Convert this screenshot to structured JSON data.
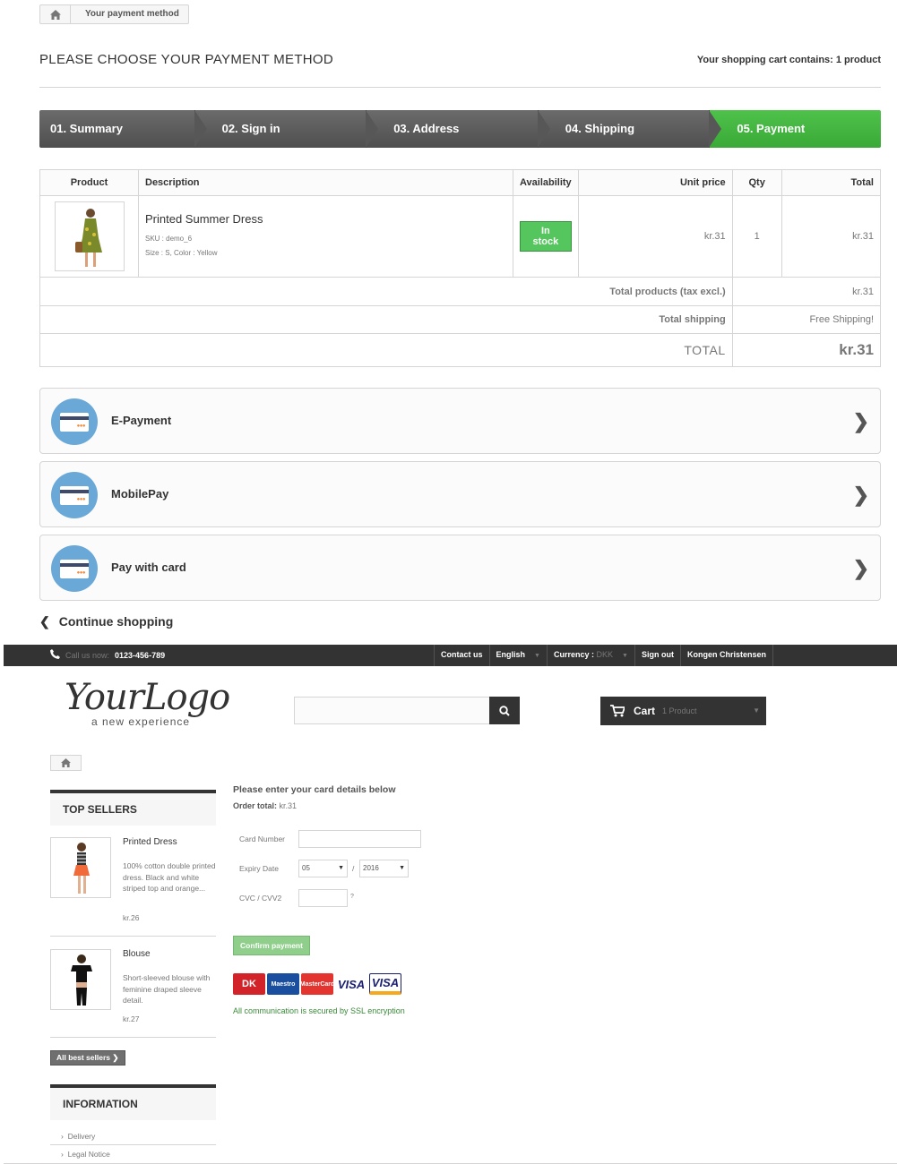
{
  "breadcrumb": {
    "current": "Your payment method"
  },
  "page_title": "PLEASE CHOOSE YOUR PAYMENT METHOD",
  "cart_summary": "Your shopping cart contains: 1 product",
  "steps": [
    {
      "label": "01. Summary"
    },
    {
      "label": "02. Sign in"
    },
    {
      "label": "03. Address"
    },
    {
      "label": "04. Shipping"
    },
    {
      "label": "05. Payment"
    }
  ],
  "colors": {
    "active_step": "#46b743",
    "step": "#575757",
    "icon_bg": "#6aa8d8"
  },
  "cart_table": {
    "headers": [
      "Product",
      "Description",
      "Availability",
      "Unit price",
      "Qty",
      "Total"
    ],
    "item": {
      "name": "Printed Summer Dress",
      "sku": "SKU : demo_6",
      "attributes": "Size : S, Color : Yellow",
      "availability": "In stock",
      "unit_price": "kr.31",
      "qty": "1",
      "total": "kr.31"
    },
    "total_products_label": "Total products (tax excl.)",
    "total_products_value": "kr.31",
    "total_shipping_label": "Total shipping",
    "total_shipping_value": "Free Shipping!",
    "total_label": "TOTAL",
    "total_value": "kr.31"
  },
  "payment_methods": [
    {
      "label": "E-Payment",
      "icon": "credit-card-icon"
    },
    {
      "label": "MobilePay",
      "icon": "credit-card-icon"
    },
    {
      "label": "Pay with card",
      "icon": "credit-card-icon"
    }
  ],
  "continue_shopping": "Continue shopping",
  "store": {
    "nav": {
      "call_label": "Call us now:",
      "phone": "0123-456-789",
      "contact": "Contact us",
      "language": "English",
      "currency_label": "Currency :",
      "currency_value": "DKK",
      "sign_out": "Sign out",
      "user": "Kongen Christensen"
    },
    "logo": {
      "main": "YourLogo",
      "tagline": "a new experience"
    },
    "search": {
      "placeholder": ""
    },
    "cart": {
      "label": "Cart",
      "qty": "1 Product"
    },
    "top_sellers": {
      "title": "TOP SELLERS",
      "items": [
        {
          "name": "Printed Dress",
          "desc": "100% cotton double printed dress. Black and white striped top and orange...",
          "price": "kr.26"
        },
        {
          "name": "Blouse",
          "desc": "Short-sleeved blouse with feminine draped sleeve detail.",
          "price": "kr.27"
        }
      ],
      "all_button": "All best sellers"
    },
    "information": {
      "title": "INFORMATION",
      "links": [
        "Delivery",
        "Legal Notice"
      ]
    },
    "card_form": {
      "title": "Please enter your card details below",
      "order_total_label": "Order total:",
      "order_total_value": "kr.31",
      "card_number_label": "Card Number",
      "expiry_label": "Expiry Date",
      "expiry_month": "05",
      "expiry_sep": "/",
      "expiry_year": "2016",
      "cvc_label": "CVC / CVV2",
      "cvc_help": "?",
      "confirm": "Confirm payment",
      "card_logos": [
        "DK",
        "Maestro",
        "MasterCard",
        "VISA",
        "VISA"
      ],
      "ssl_note": "All communication is secured by SSL encryption"
    }
  }
}
